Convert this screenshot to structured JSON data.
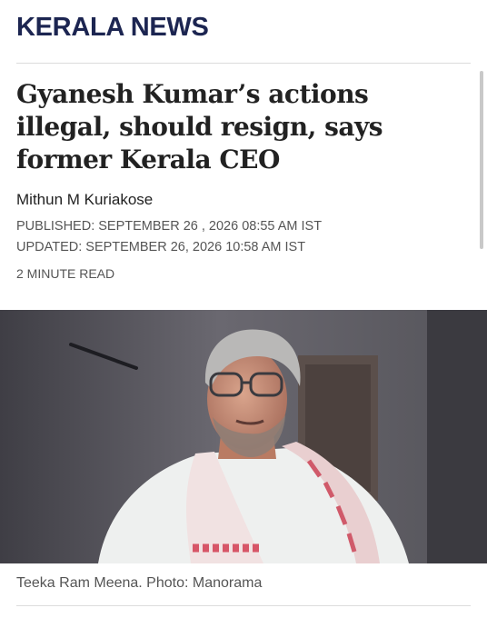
{
  "section": {
    "title": "KERALA NEWS"
  },
  "article": {
    "headline": "Gyanesh Kumar’s actions illegal, should resign, says former Kerala CEO",
    "author": "Mithun M Kuriakose",
    "published": "PUBLISHED: SEPTEMBER 26 , 2026 08:55 AM IST",
    "updated": "UPDATED: SEPTEMBER 26, 2026 10:58 AM IST",
    "read_time": "2 MINUTE READ"
  },
  "photo": {
    "caption": "Teeka Ram Meena. Photo: Manorama"
  },
  "colors": {
    "brand_navy": "#1c2551",
    "text_dark": "#222222",
    "text_meta": "#555555",
    "divider": "#dcdcdc"
  }
}
